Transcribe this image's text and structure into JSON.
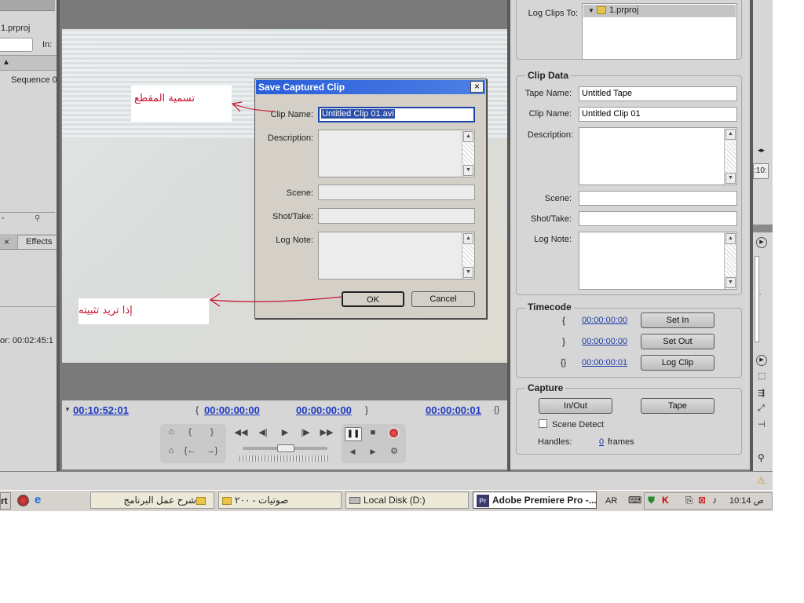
{
  "left_panel": {
    "project_file": "1.prproj",
    "in_label": "In:",
    "sequence": "Sequence 0",
    "tab_effects": "Effects",
    "tab_close": "×",
    "duration": "or: 00:02:45:1"
  },
  "monitor": {
    "tc_current": "00:10:52:01",
    "tc_in": "00:00:00:00",
    "tc_out": "00:00:00:00",
    "tc_duration": "00:00:00:01"
  },
  "dialog": {
    "title": "Save Captured Clip",
    "close": "×",
    "clip_name_label": "Clip Name:",
    "clip_name_value": "Untitled Clip 01.avi",
    "description_label": "Description:",
    "scene_label": "Scene:",
    "shot_label": "Shot/Take:",
    "log_note_label": "Log Note:",
    "ok": "OK",
    "cancel": "Cancel"
  },
  "annotations": {
    "clip_naming": "تسمية المقطع",
    "confirm": "إذا تريد تثبيته"
  },
  "capture_panel": {
    "log_clips_to_label": "Log Clips To:",
    "log_clips_to_item": "1.prproj",
    "clip_data_title": "Clip Data",
    "tape_name_label": "Tape Name:",
    "tape_name_value": "Untitled Tape",
    "clip_name_label": "Clip Name:",
    "clip_name_value": "Untitled Clip 01",
    "description_label": "Description:",
    "scene_label": "Scene:",
    "shot_label": "Shot/Take:",
    "log_note_label": "Log Note:",
    "timecode_title": "Timecode",
    "tc_in": "00:00:00:00",
    "tc_out": "00:00:00:00",
    "tc_dur": "00:00:00:01",
    "set_in": "Set In",
    "set_out": "Set Out",
    "log_clip": "Log Clip",
    "capture_title": "Capture",
    "in_out": "In/Out",
    "tape": "Tape",
    "scene_detect": "Scene Detect",
    "handles_label": "Handles:",
    "handles_value": "0",
    "handles_unit": "frames"
  },
  "right_strip": {
    "tc_fragment": ":10:"
  },
  "taskbar": {
    "start_fragment": "rt",
    "items": [
      "شرح عمل البرنامج",
      "صوتيات - ٢٠٠",
      "Local Disk (D:)",
      "Adobe Premiere Pro -..."
    ],
    "pr_badge": "Pr",
    "lang": "AR",
    "time": "10:14 ص"
  },
  "colors": {
    "panel_bg": "#d6d6d6",
    "timecode_blue": "#1e3ac0",
    "dialog_title_bg": "#2a5ed8",
    "annotation_red": "#c8102e"
  }
}
